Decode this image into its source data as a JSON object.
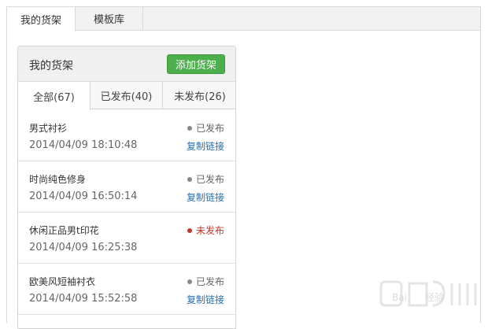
{
  "top_tabs": {
    "my_shelf": "我的货架",
    "template_library": "模板库"
  },
  "panel": {
    "title": "我的货架",
    "add_button": "添加货架"
  },
  "sub_tabs": {
    "all": "全部(67)",
    "published": "已发布(40)",
    "unpublished": "未发布(26)"
  },
  "items": [
    {
      "name": "男式衬衫",
      "date": "2014/04/09 18:10:48",
      "status": "已发布",
      "link": "复制链接"
    },
    {
      "name": "时尚纯色修身",
      "date": "2014/04/09 16:50:14",
      "status": "已发布",
      "link": "复制链接"
    },
    {
      "name": "休闲正品男t印花",
      "date": "2014/04/09 16:25:38",
      "status": "未发布",
      "link": ""
    },
    {
      "name": "欧美风短袖衬衣",
      "date": "2014/04/09 15:52:58",
      "status": "已发布",
      "link": "复制链接"
    }
  ],
  "colors": {
    "add_button_bg": "#4cae4c",
    "published": "#888888",
    "unpublished": "#c0392b",
    "link": "#2a6fb0"
  },
  "watermark": {
    "text": "Baidu 经验"
  }
}
